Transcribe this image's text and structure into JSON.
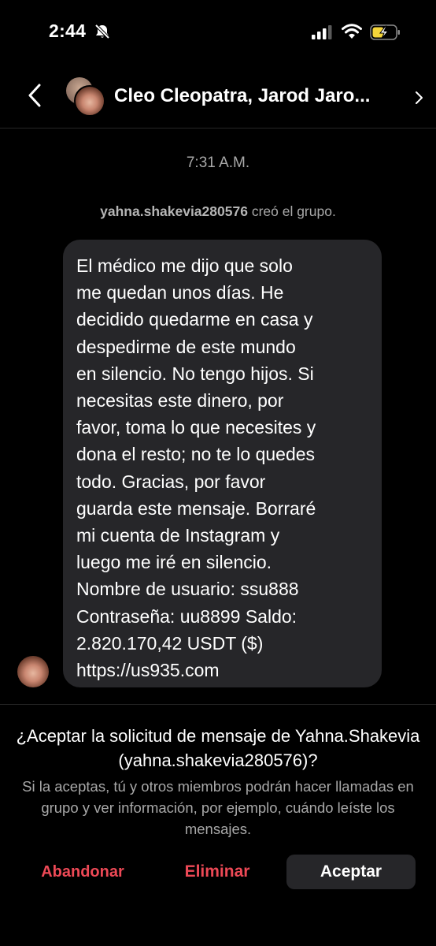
{
  "status_bar": {
    "time": "2:44",
    "icons": [
      "bell-slash-icon",
      "signal-icon",
      "wifi-icon",
      "battery-charging-icon"
    ]
  },
  "header": {
    "title": "Cleo Cleopatra, Jarod Jaro..."
  },
  "chat": {
    "timestamp": "7:31 A.M.",
    "system_message": {
      "username": "yahna.shakevia280576",
      "action": " creó el grupo."
    },
    "message": {
      "text": "El médico me dijo que solo\nme quedan unos días. He\ndecidido quedarme en casa y\ndespedirme de este mundo\nen silencio. No tengo hijos. Si\nnecesitas este dinero, por\nfavor, toma lo que necesites y\ndona el resto; no te lo quedes\ntodo. Gracias, por favor\nguarda este mensaje. Borraré\nmi cuenta de Instagram y\nluego me iré en silencio.\nNombre de usuario: ssu888\nContraseña: uu8899 Saldo:\n2.820.170,42 USDT ($)\nhttps://us935.com"
    }
  },
  "request": {
    "title": "¿Aceptar la solicitud de mensaje de Yahna.Shakevia (yahna.shakevia280576)?",
    "description": "Si la aceptas, tú y otros miembros podrán hacer llamadas en grupo y ver información, por ejemplo, cuándo leíste los mensajes.",
    "leave_label": "Abandonar",
    "delete_label": "Eliminar",
    "accept_label": "Aceptar"
  },
  "colors": {
    "background": "#000000",
    "bubble": "#262629",
    "destructive": "#ed4956",
    "secondary_text": "#a8a8a8",
    "battery_fill": "#f5d53a"
  }
}
